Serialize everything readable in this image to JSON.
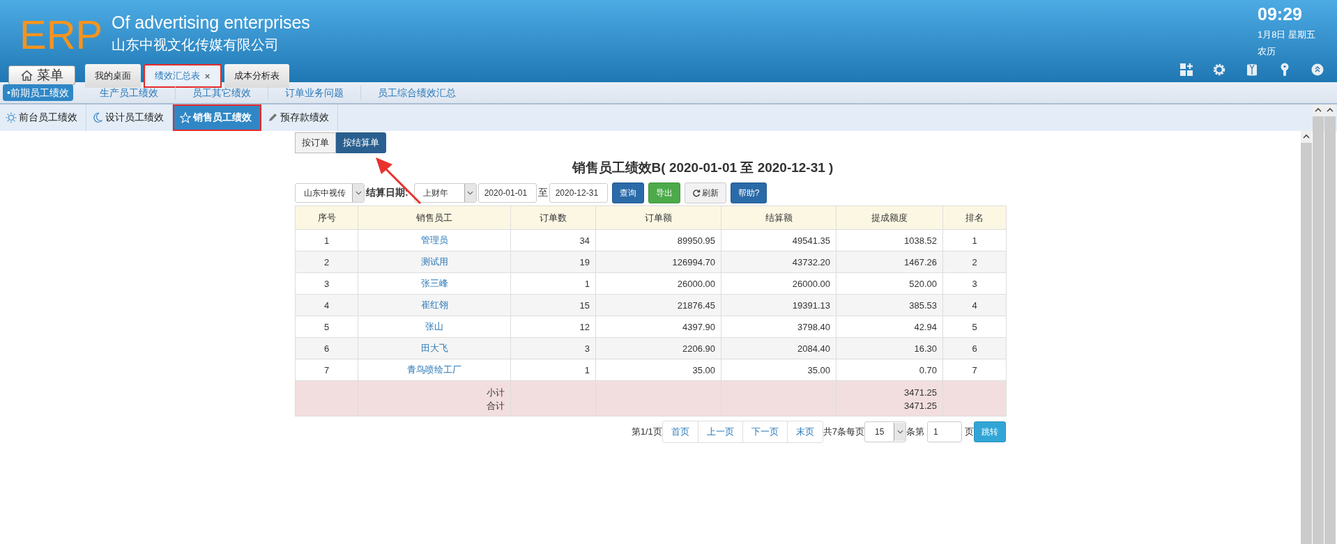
{
  "header": {
    "logo": "ERP",
    "tagline": "Of advertising enterprises",
    "company": "山东中视文化传媒有限公司",
    "clock": {
      "time": "09:29",
      "date": "1月8日 星期五",
      "lunar": "农历"
    },
    "menu_button": "菜单"
  },
  "tabs": [
    {
      "label": "我的桌面",
      "selected": false,
      "closable": false,
      "highlighted": false
    },
    {
      "label": "绩效汇总表",
      "selected": true,
      "closable": true,
      "highlighted": true
    },
    {
      "label": "成本分析表",
      "selected": false,
      "closable": false,
      "highlighted": false
    }
  ],
  "subnav": [
    {
      "label": "•前期员工绩效",
      "selected": true
    },
    {
      "label": "生产员工绩效",
      "selected": false
    },
    {
      "label": "员工其它绩效",
      "selected": false
    },
    {
      "label": "订单业务问题",
      "selected": false
    },
    {
      "label": "员工综合绩效汇总",
      "selected": false
    }
  ],
  "category_tabs": [
    {
      "label": "前台员工绩效",
      "kind": "sun",
      "selected": false,
      "highlighted": false
    },
    {
      "label": "设计员工绩效",
      "kind": "moon",
      "selected": false,
      "highlighted": false
    },
    {
      "label": "销售员工绩效",
      "kind": "star",
      "selected": true,
      "highlighted": true
    },
    {
      "label": "预存款绩效",
      "kind": "pencil",
      "selected": false,
      "highlighted": false
    }
  ],
  "mode_buttons": [
    {
      "label": "按订单",
      "selected": false
    },
    {
      "label": "按结算单",
      "selected": true
    }
  ],
  "report": {
    "title": "销售员工绩效B( 2020-01-01 至 2020-12-31 )",
    "filters": {
      "company": "山东中视传",
      "date_label": "结算日期:",
      "period": "上财年",
      "start": "2020-01-01",
      "separator": "至",
      "end": "2020-12-31",
      "buttons": [
        {
          "label": "查询",
          "kind": "primary"
        },
        {
          "label": "导出",
          "kind": "success"
        },
        {
          "label": "刷新",
          "kind": "refresh"
        },
        {
          "label": "帮助?",
          "kind": "primary"
        }
      ]
    },
    "table": {
      "columns": [
        "序号",
        "销售员工",
        "订单数",
        "订单额",
        "结算额",
        "提成额度",
        "排名"
      ],
      "rows": [
        [
          "1",
          "管理员",
          "34",
          "89950.95",
          "49541.35",
          "1038.52",
          "1"
        ],
        [
          "2",
          "测试用",
          "19",
          "126994.70",
          "43732.20",
          "1467.26",
          "2"
        ],
        [
          "3",
          "张三峰",
          "1",
          "26000.00",
          "26000.00",
          "520.00",
          "3"
        ],
        [
          "4",
          "崔红翎",
          "15",
          "21876.45",
          "19391.13",
          "385.53",
          "4"
        ],
        [
          "5",
          "张山",
          "12",
          "4397.90",
          "3798.40",
          "42.94",
          "5"
        ],
        [
          "6",
          "田大飞",
          "3",
          "2206.90",
          "2084.40",
          "16.30",
          "6"
        ],
        [
          "7",
          "青鸟喷绘工厂",
          "1",
          "35.00",
          "35.00",
          "0.70",
          "7"
        ]
      ],
      "totals": [
        {
          "label": "小计",
          "commission": "3471.25"
        },
        {
          "label": "合计",
          "commission": "3471.25"
        }
      ]
    },
    "pagination": {
      "page_info": "第1/1页",
      "links": [
        "首页",
        "上一页",
        "下一页",
        "末页"
      ],
      "total_info": "共7条每页",
      "page_size": "15",
      "goto_label": "条第",
      "goto_page": "1",
      "page_suffix": "页",
      "goto_button": "跳转"
    }
  }
}
